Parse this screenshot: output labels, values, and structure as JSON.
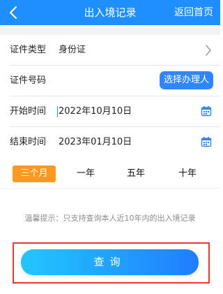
{
  "header": {
    "title": "出入境记录",
    "home_link": "返回首页"
  },
  "form": {
    "id_type": {
      "label": "证件类型",
      "value": "身份证"
    },
    "id_number": {
      "label": "证件号码",
      "value": "",
      "pick_button": "选择办理人"
    },
    "start_date": {
      "label": "开始时间",
      "value": "2022年10月10日"
    },
    "end_date": {
      "label": "结束时间",
      "value": "2023年01月10日"
    }
  },
  "period_tabs": [
    {
      "label": "三个月",
      "active": true
    },
    {
      "label": "一年",
      "active": false
    },
    {
      "label": "五年",
      "active": false
    },
    {
      "label": "十年",
      "active": false
    }
  ],
  "tip": "温馨提示：只支持查询本人近10年内的出入境记录",
  "query_button": "查询",
  "colors": {
    "header_bg": "#1f8fff",
    "primary": "#2f86ff",
    "tab_active": "#ff9a1f",
    "highlight": "#e53935"
  }
}
